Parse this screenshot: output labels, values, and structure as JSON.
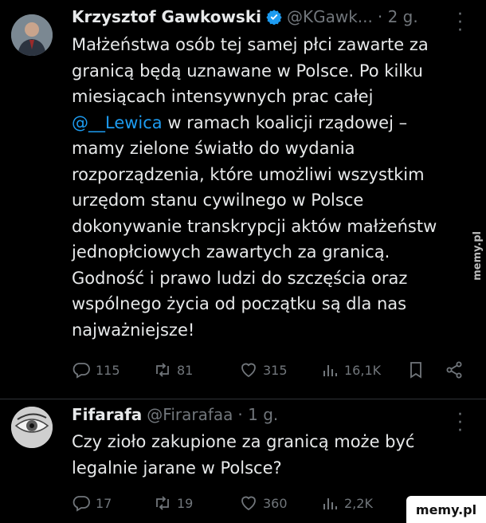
{
  "tweets": [
    {
      "author_name": "Krzysztof Gawkowski",
      "handle": "@KGawk...",
      "time": "· 2 g.",
      "text_lines": [
        "Małżeństwa osób tej samej płci zawarte za",
        "granicą będą uznawane w Polsce. Po kilku",
        "miesiącach intensywnych prac całej",
        "w ramach koalicji rządowej –",
        "mamy zielone światło do wydania",
        "rozporządzenia, które umożliwi wszystkim",
        "urzędom stanu cywilnego w Polsce",
        "dokonywanie transkrypcji aktów małżeństw",
        "jednopłciowych zawartych za granicą.",
        "Godność i prawo ludzi do szczęścia oraz",
        "wspólnego życia od początku są dla nas",
        "najważniejsze!"
      ],
      "mention": "@__Lewica",
      "stats": {
        "replies": "115",
        "retweets": "81",
        "likes": "315",
        "views": "16,1K"
      }
    },
    {
      "author_name": "Fifarafa",
      "handle": "@Firarafaa",
      "time": "· 1 g.",
      "text_lines": [
        "Czy zioło zakupione za granicą może być",
        "legalnie jarane w Polsce?"
      ],
      "stats": {
        "replies": "17",
        "retweets": "19",
        "likes": "360",
        "views": "2,2K"
      }
    }
  ],
  "watermarks": {
    "side": "memy.pl",
    "corner": "memy.pl"
  },
  "colors": {
    "background": "#000000",
    "text": "#e7e9ea",
    "muted": "#71767b",
    "link": "#1d9bf0",
    "verified": "#1d9bf0"
  },
  "icons": [
    "verified-badge-icon",
    "more-icon",
    "reply-icon",
    "retweet-icon",
    "like-icon",
    "views-icon",
    "bookmark-icon",
    "share-icon"
  ]
}
